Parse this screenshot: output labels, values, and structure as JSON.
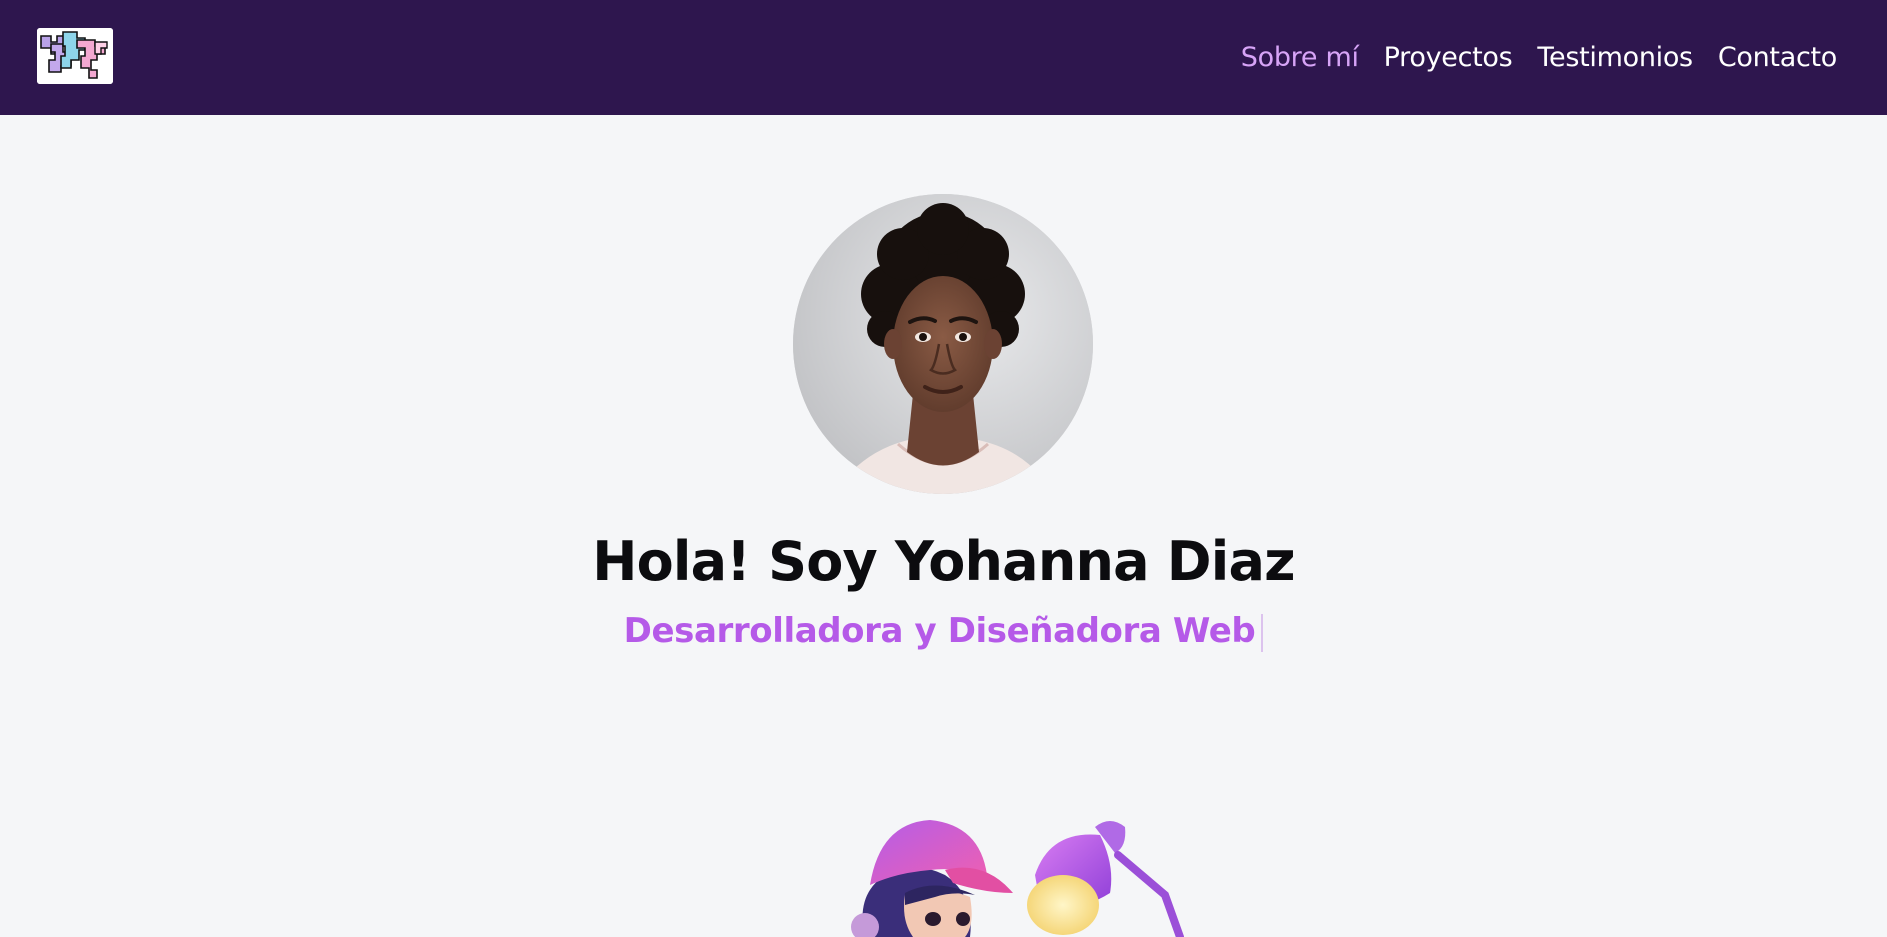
{
  "header": {
    "logo_name": "site-logo",
    "nav": [
      {
        "label": "Sobre mí",
        "active": true
      },
      {
        "label": "Proyectos",
        "active": false
      },
      {
        "label": "Testimonios",
        "active": false
      },
      {
        "label": "Contacto",
        "active": false
      }
    ]
  },
  "hero": {
    "title": "Hola! Soy Yohanna Diaz",
    "subtitle": "Desarrolladora y Diseñadora Web"
  },
  "colors": {
    "navbar_bg": "#2e164e",
    "nav_active": "#d7a4f7",
    "accent": "#b55ae8",
    "page_bg": "#f5f6f8"
  }
}
